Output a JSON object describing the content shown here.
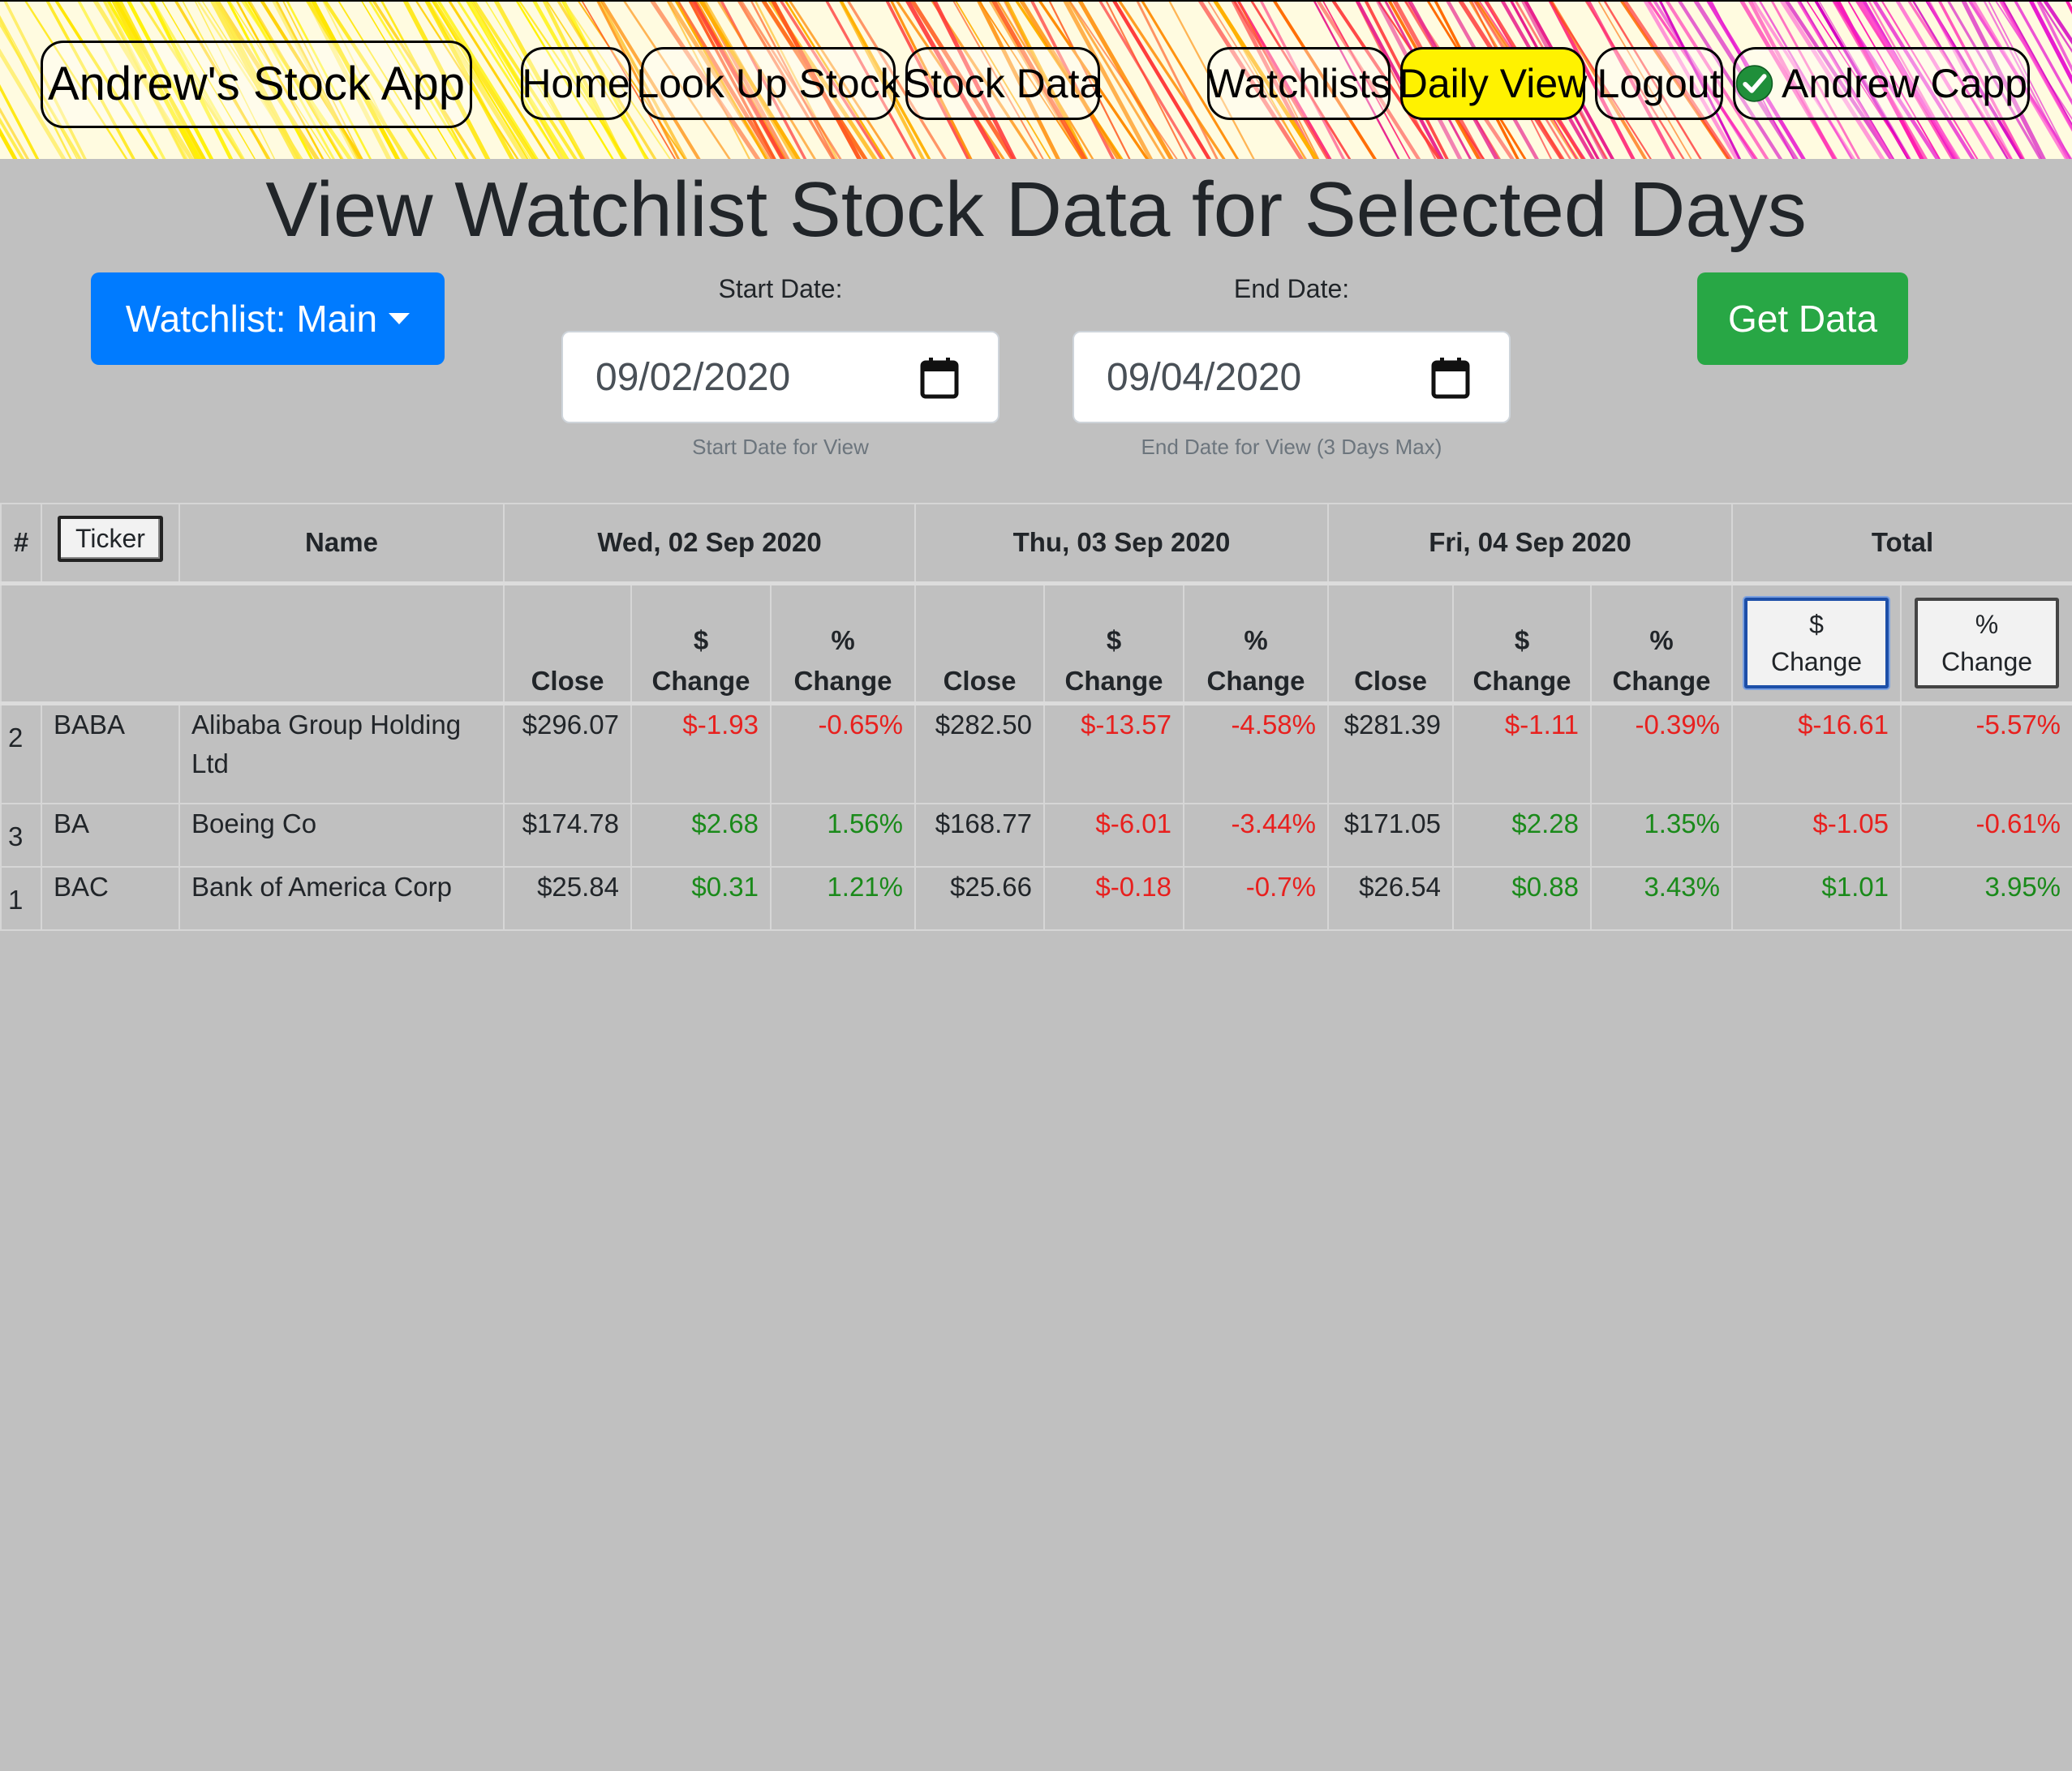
{
  "nav": {
    "app_title": "Andrew's Stock App",
    "home": "Home",
    "lookup": "Look Up Stock",
    "stock_data": "Stock Data",
    "watchlists": "Watchlists",
    "daily_view": "Daily View",
    "logout": "Logout",
    "user": "Andrew Capp",
    "user_icon": "check-circle-icon",
    "active_color": "#fff200"
  },
  "page": {
    "title": "View Watchlist Stock Data for Selected Days",
    "watchlist_button": "Watchlist: Main",
    "start_label": "Start Date:",
    "start_value": "09/02/2020",
    "start_help": "Start Date for View",
    "end_label": "End Date:",
    "end_value": "09/04/2020",
    "end_help": "End Date for View (3 Days Max)",
    "get_data": "Get Data",
    "primary_color": "#007bff",
    "success_color": "#28a745"
  },
  "table": {
    "headers": {
      "num": "#",
      "ticker": "Ticker",
      "name": "Name",
      "day1": "Wed, 02 Sep 2020",
      "day2": "Thu, 03 Sep 2020",
      "day3": "Fri, 04 Sep 2020",
      "total": "Total",
      "close": "Close",
      "dollar_sym": "$",
      "pct_sym": "%",
      "change": "Change"
    },
    "rows": [
      {
        "num": "2",
        "ticker": "BABA",
        "name": "Alibaba Group Holding Ltd",
        "d1_close": "$296.07",
        "d1_dchg": "$-1.93",
        "d1_pchg": "-0.65%",
        "d2_close": "$282.50",
        "d2_dchg": "$-13.57",
        "d2_pchg": "-4.58%",
        "d3_close": "$281.39",
        "d3_dchg": "$-1.11",
        "d3_pchg": "-0.39%",
        "t_dchg": "$-16.61",
        "t_pchg": "-5.57%"
      },
      {
        "num": "3",
        "ticker": "BA",
        "name": "Boeing Co",
        "d1_close": "$174.78",
        "d1_dchg": "$2.68",
        "d1_pchg": "1.56%",
        "d2_close": "$168.77",
        "d2_dchg": "$-6.01",
        "d2_pchg": "-3.44%",
        "d3_close": "$171.05",
        "d3_dchg": "$2.28",
        "d3_pchg": "1.35%",
        "t_dchg": "$-1.05",
        "t_pchg": "-0.61%"
      },
      {
        "num": "1",
        "ticker": "BAC",
        "name": "Bank of America Corp",
        "d1_close": "$25.84",
        "d1_dchg": "$0.31",
        "d1_pchg": "1.21%",
        "d2_close": "$25.66",
        "d2_dchg": "$-0.18",
        "d2_pchg": "-0.7%",
        "d3_close": "$26.54",
        "d3_dchg": "$0.88",
        "d3_pchg": "3.43%",
        "t_dchg": "$1.01",
        "t_pchg": "3.95%"
      }
    ],
    "positive_color": "#1a8a1a",
    "negative_color": "#e8201e"
  }
}
